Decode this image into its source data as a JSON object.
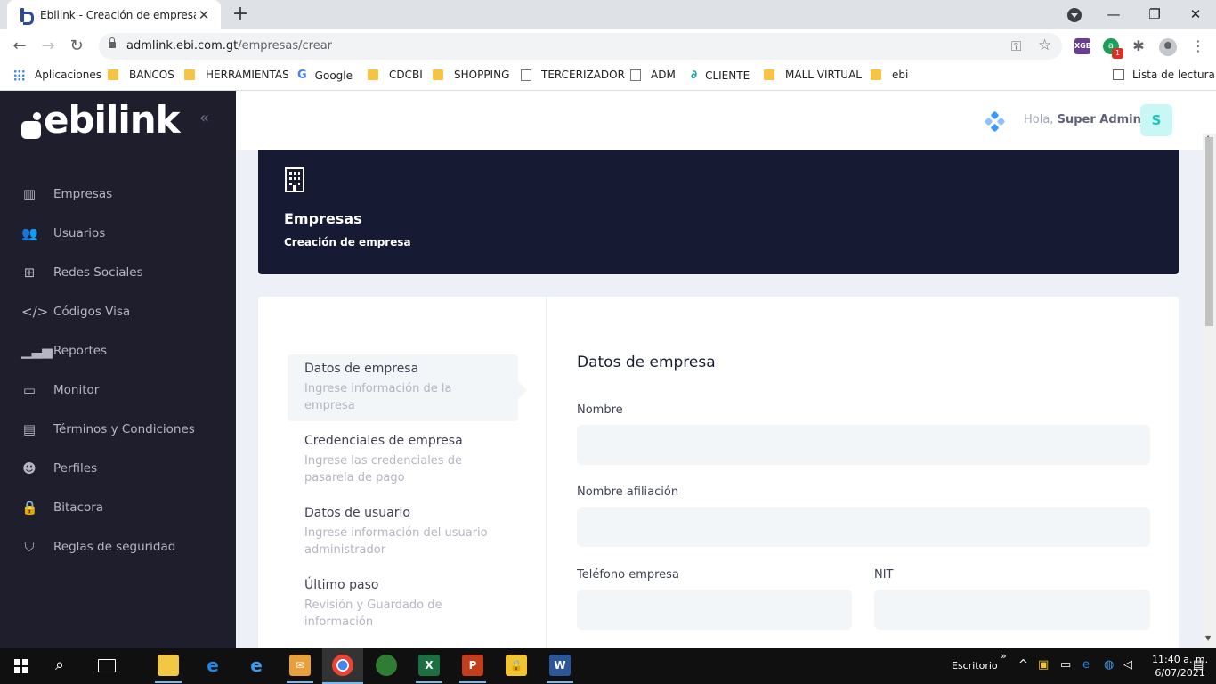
{
  "browser": {
    "tab_title": "Ebilink - Creación de empresa",
    "tab_close": "✕",
    "new_tab": "+",
    "url_host": "admlink.ebi.com.gt",
    "url_path": "/empresas/crear",
    "ext_xgb": "XGB",
    "ext_g": "a",
    "ext_badge": "1",
    "bookmarks": [
      {
        "label": "Aplicaciones",
        "icon": "apps-icon"
      },
      {
        "label": "BANCOS",
        "icon": "folder-icon"
      },
      {
        "label": "HERRAMIENTAS",
        "icon": "folder-icon"
      },
      {
        "label": "Google",
        "icon": "google-icon"
      },
      {
        "label": "CDCBI",
        "icon": "folder-icon"
      },
      {
        "label": "SHOPPING",
        "icon": "folder-icon"
      },
      {
        "label": "TERCERIZADOR",
        "icon": "doc-icon"
      },
      {
        "label": "ADM",
        "icon": "doc-icon"
      },
      {
        "label": "CLIENTE",
        "icon": "link-icon"
      },
      {
        "label": "MALL VIRTUAL",
        "icon": "folder-icon"
      },
      {
        "label": "ebi",
        "icon": "folder-icon"
      }
    ],
    "reading_list": "Lista de lectura"
  },
  "sidebar": {
    "logo_text": "ebilink",
    "items": [
      {
        "label": "Empresas",
        "icon": "building-icon"
      },
      {
        "label": "Usuarios",
        "icon": "users-icon"
      },
      {
        "label": "Redes Sociales",
        "icon": "network-icon"
      },
      {
        "label": "Códigos Visa",
        "icon": "code-icon"
      },
      {
        "label": "Reportes",
        "icon": "chart-icon"
      },
      {
        "label": "Monitor",
        "icon": "monitor-icon"
      },
      {
        "label": "Términos y Condiciones",
        "icon": "document-icon"
      },
      {
        "label": "Perfiles",
        "icon": "profiles-icon"
      },
      {
        "label": "Bitacora",
        "icon": "lock-icon"
      },
      {
        "label": "Reglas de seguridad",
        "icon": "shield-icon"
      }
    ]
  },
  "header": {
    "greeting_prefix": "Hola,",
    "user_name": "Super Admin",
    "avatar_letter": "S"
  },
  "banner": {
    "title": "Empresas",
    "subtitle": "Creación de empresa"
  },
  "wizard": {
    "steps": [
      {
        "title": "Datos de empresa",
        "desc": "Ingrese información de la empresa",
        "active": true
      },
      {
        "title": "Credenciales de empresa",
        "desc": "Ingrese las credenciales de pasarela de pago",
        "active": false
      },
      {
        "title": "Datos de usuario",
        "desc": "Ingrese información del usuario administrador",
        "active": false
      },
      {
        "title": "Último paso",
        "desc": "Revisión y Guardado de información",
        "active": false
      }
    ],
    "form_title": "Datos de empresa",
    "fields": {
      "nombre_label": "Nombre",
      "nombre_value": "",
      "afiliacion_label": "Nombre afiliación",
      "afiliacion_value": "",
      "telefono_label": "Teléfono empresa",
      "telefono_value": "",
      "nit_label": "NIT",
      "nit_value": ""
    }
  },
  "taskbar": {
    "escritorio": "Escritorio",
    "time": "11:40 a. m.",
    "date": "6/07/2021"
  },
  "colors": {
    "sidebar_bg": "#1e1e2d",
    "banner_bg": "#161b33",
    "avatar_bg": "#c9f7f5",
    "avatar_fg": "#1bc5bd"
  }
}
